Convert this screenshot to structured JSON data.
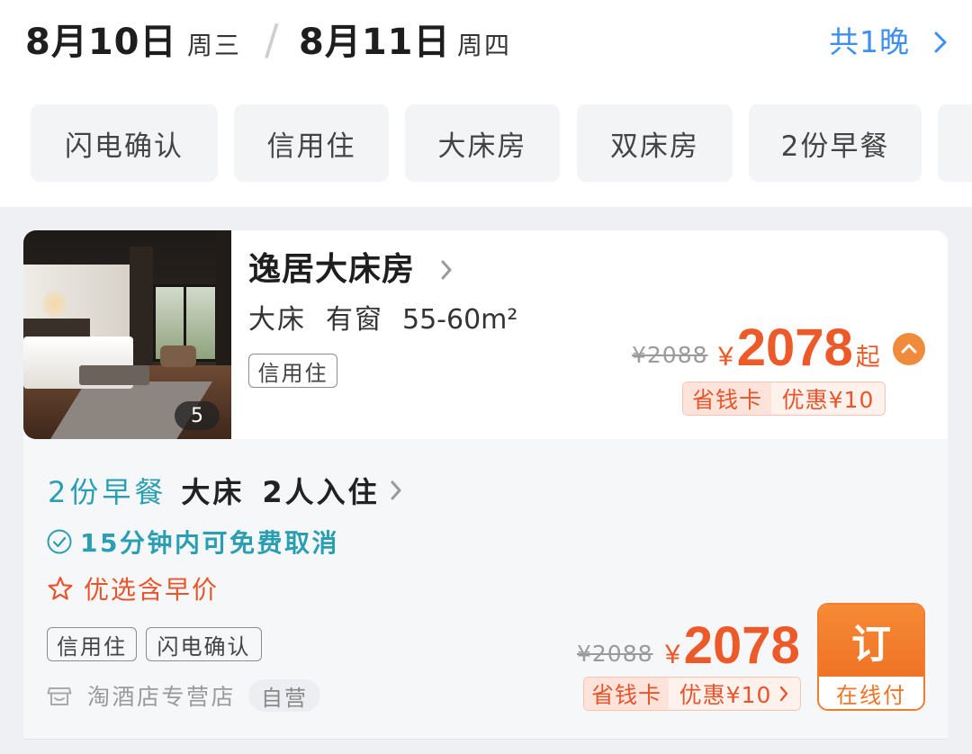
{
  "header": {
    "checkin_date": "8月10日",
    "checkin_weekday": "周三",
    "separator": "/",
    "checkout_date": "8月11日",
    "checkout_weekday": "周四",
    "nights": "共1晚"
  },
  "filters": [
    "闪电确认",
    "信用住",
    "大床房",
    "双床房",
    "2份早餐"
  ],
  "room": {
    "name": "逸居大床房",
    "bed": "大床",
    "window": "有窗",
    "area": "55-60m²",
    "tags": [
      "信用住"
    ],
    "photo_count": "5",
    "original_price": "¥2088",
    "currency": "¥",
    "price": "2078",
    "price_suffix": "起",
    "saver_card": "省钱卡",
    "discount": "优惠¥10"
  },
  "rate_plan": {
    "breakfast": "2份早餐",
    "bed": "大床",
    "occupancy": "2人入住",
    "cancel_policy": "15分钟内可免费取消",
    "promo": "优选含早价",
    "tags": [
      "信用住",
      "闪电确认"
    ],
    "seller": "淘酒店专营店",
    "seller_badge": "自营",
    "original_price": "¥2088",
    "currency": "¥",
    "price": "2078",
    "saver_card": "省钱卡",
    "discount": "优惠¥10",
    "book_label": "订",
    "pay_label": "在线付"
  },
  "icons": {
    "nights": "chevron-right-icon",
    "room_details": "chevron-right-icon",
    "room_expand": "chevron-up-circle-icon",
    "rate_details": "chevron-right-icon",
    "cancel_policy": "check-circle-icon",
    "promo": "star-icon",
    "seller": "store-icon",
    "discount_details": "chevron-right-icon"
  },
  "colors": {
    "price": "#ec5a2a",
    "cancel_policy": "#2a9fb3",
    "link": "#3d8ff0",
    "book_button": "#f27c2e",
    "promo": "#e8552b",
    "chip_background": "#f3f4f6"
  }
}
